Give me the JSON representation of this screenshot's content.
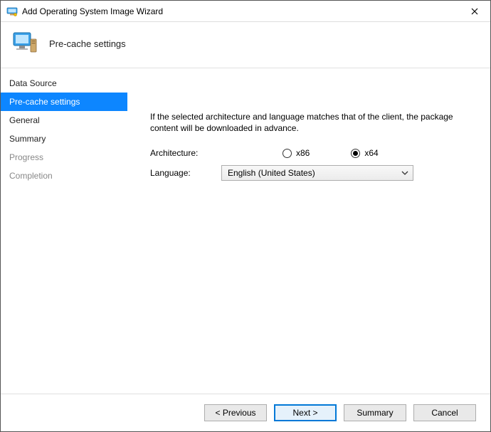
{
  "window": {
    "title": "Add Operating System Image Wizard"
  },
  "header": {
    "page_title": "Pre-cache settings"
  },
  "sidebar": {
    "items": [
      {
        "label": "Data Source",
        "state": "normal"
      },
      {
        "label": "Pre-cache settings",
        "state": "active"
      },
      {
        "label": "General",
        "state": "normal"
      },
      {
        "label": "Summary",
        "state": "normal"
      },
      {
        "label": "Progress",
        "state": "disabled"
      },
      {
        "label": "Completion",
        "state": "disabled"
      }
    ]
  },
  "content": {
    "description": "If the selected architecture and language matches that of the client, the package content will be downloaded in advance.",
    "architecture_label": "Architecture:",
    "architecture_options": {
      "x86": "x86",
      "x64": "x64",
      "selected": "x64"
    },
    "language_label": "Language:",
    "language_selected": "English (United States)"
  },
  "footer": {
    "previous": "< Previous",
    "next": "Next >",
    "summary": "Summary",
    "cancel": "Cancel"
  }
}
